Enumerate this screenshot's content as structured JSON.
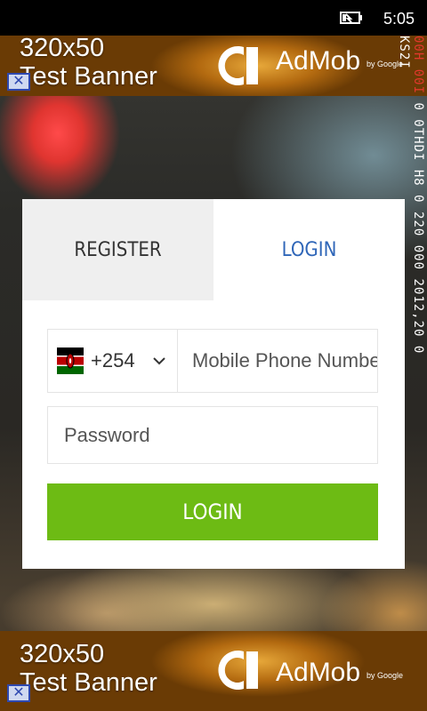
{
  "status_bar": {
    "time": "5:05"
  },
  "ads": {
    "top": {
      "line1": "320x50",
      "line2": "Test Banner",
      "brand": "AdMob",
      "by": "by Google",
      "close": "✕"
    },
    "bottom": {
      "line1": "320x50",
      "line2": "Test Banner",
      "brand": "AdMob",
      "by": "by Google",
      "close": "✕"
    }
  },
  "debug_text": {
    "red_part": "00H 00I",
    "white_part": "0 0THDI H8 0 220 000 2012,20 0 KS2I"
  },
  "tabs": [
    {
      "label": "REGISTER",
      "active": false
    },
    {
      "label": "LOGIN",
      "active": true
    }
  ],
  "form": {
    "country_code": "+254",
    "country_flag": "kenya-flag-icon",
    "phone_placeholder": "Mobile Phone Number",
    "password_placeholder": "Password",
    "login_button": "LOGIN"
  },
  "colors": {
    "accent_blue": "#2f66b8",
    "button_green": "#6dbb14",
    "inactive_tab": "#efefef"
  }
}
